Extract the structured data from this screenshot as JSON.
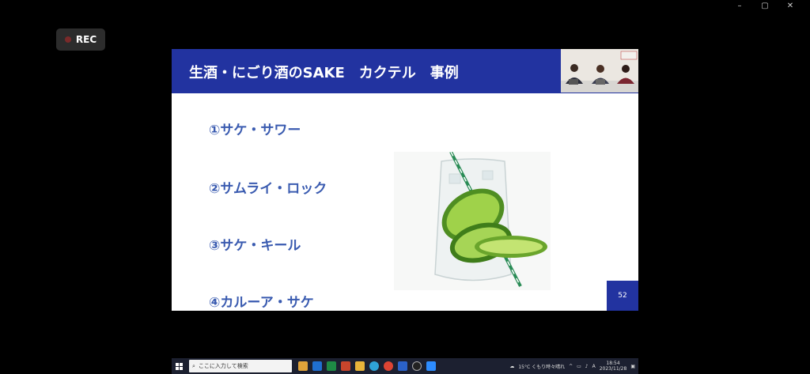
{
  "window": {
    "controls": [
      "–",
      "▢",
      "✕"
    ]
  },
  "recording": {
    "label": "REC"
  },
  "slide": {
    "title": "生酒・にごり酒のSAKE　カクテル　事例",
    "items": [
      "①サケ・サワー",
      "②サムライ・ロック",
      "③サケ・キール",
      "④カルーア・サケ"
    ],
    "page_number": "52"
  },
  "taskbar": {
    "search_placeholder": "ここに入力して検索",
    "weather": "15°C くもり時々晴れ",
    "ime": "A",
    "time": "18:54",
    "date": "2023/11/28"
  }
}
